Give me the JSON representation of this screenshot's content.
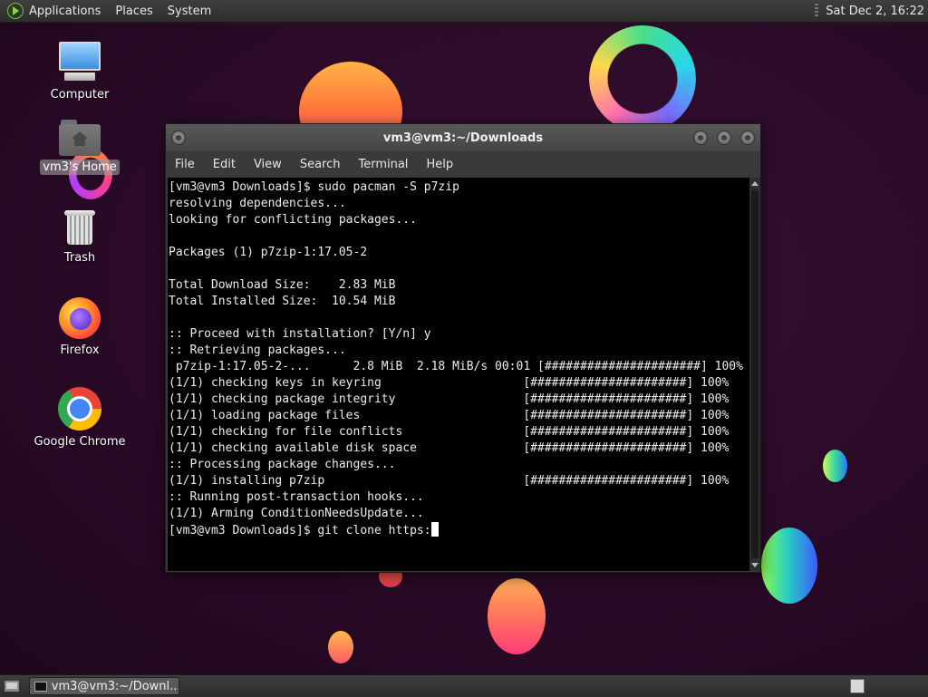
{
  "top_panel": {
    "menus": [
      "Applications",
      "Places",
      "System"
    ],
    "clock": "Sat Dec 2, 16:22"
  },
  "desktop": {
    "icons": [
      {
        "label": "Computer",
        "icon": "computer-icon"
      },
      {
        "label": "vm3's Home",
        "icon": "home-folder-icon"
      },
      {
        "label": "Trash",
        "icon": "trash-icon"
      },
      {
        "label": "Firefox",
        "icon": "firefox-icon"
      },
      {
        "label": "Google Chrome",
        "icon": "chrome-icon"
      }
    ]
  },
  "terminal": {
    "title": "vm3@vm3:~/Downloads",
    "menu": [
      "File",
      "Edit",
      "View",
      "Search",
      "Terminal",
      "Help"
    ],
    "lines": [
      "[vm3@vm3 Downloads]$ sudo pacman -S p7zip",
      "resolving dependencies...",
      "looking for conflicting packages...",
      "",
      "Packages (1) p7zip-1:17.05-2",
      "",
      "Total Download Size:    2.83 MiB",
      "Total Installed Size:  10.54 MiB",
      "",
      ":: Proceed with installation? [Y/n] y",
      ":: Retrieving packages...",
      " p7zip-1:17.05-2-...      2.8 MiB  2.18 MiB/s 00:01 [######################] 100%",
      "(1/1) checking keys in keyring                    [######################] 100%",
      "(1/1) checking package integrity                  [######################] 100%",
      "(1/1) loading package files                       [######################] 100%",
      "(1/1) checking for file conflicts                 [######################] 100%",
      "(1/1) checking available disk space               [######################] 100%",
      ":: Processing package changes...",
      "(1/1) installing p7zip                            [######################] 100%",
      ":: Running post-transaction hooks...",
      "(1/1) Arming ConditionNeedsUpdate..."
    ],
    "prompt_line": "[vm3@vm3 Downloads]$ git clone https:"
  },
  "bottom_panel": {
    "task_label": "vm3@vm3:~/Downl..."
  },
  "colors": {
    "terminal_bg": "#000000",
    "terminal_fg": "#ececec",
    "panel_bg": "#3a3a3a",
    "desktop_bg": "#2c0b29"
  }
}
